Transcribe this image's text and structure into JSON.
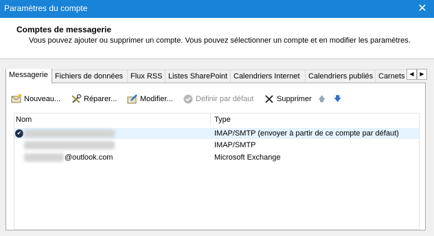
{
  "window": {
    "title": "Paramètres du compte",
    "close_glyph": "✕"
  },
  "header": {
    "title": "Comptes de messagerie",
    "description": "Vous pouvez ajouter ou supprimer un compte. Vous pouvez sélectionner un compte et en modifier les paramètres."
  },
  "tabs": [
    {
      "label": "Messagerie",
      "active": true
    },
    {
      "label": "Fichiers de données"
    },
    {
      "label": "Flux RSS"
    },
    {
      "label": "Listes SharePoint"
    },
    {
      "label": "Calendriers Internet"
    },
    {
      "label": "Calendriers publiés"
    },
    {
      "label": "Carnets d'adresses"
    }
  ],
  "tab_scroll": {
    "left": "◀",
    "right": "▶"
  },
  "toolbar": {
    "new": {
      "label": "Nouveau...",
      "icon": "new-account-icon"
    },
    "repair": {
      "label": "Réparer...",
      "icon": "repair-icon"
    },
    "modify": {
      "label": "Modifier...",
      "icon": "modify-icon"
    },
    "default": {
      "label": "Définir par défaut",
      "icon": "check-circle-icon"
    },
    "delete": {
      "label": "Supprimer",
      "icon": "delete-icon"
    },
    "up_glyph": "🡅",
    "down_glyph": "🡇"
  },
  "list": {
    "columns": {
      "name": "Nom",
      "type": "Type"
    },
    "rows": [
      {
        "name": "",
        "type": "IMAP/SMTP (envoyer à partir de ce compte par défaut)",
        "default": true
      },
      {
        "name": "",
        "type": "IMAP/SMTP"
      },
      {
        "name": "@outlook.com",
        "type": "Microsoft Exchange"
      }
    ],
    "default_glyph": "✔"
  },
  "colors": {
    "title_bar": "#1883d7",
    "selected_row": "#e5f3ff"
  }
}
